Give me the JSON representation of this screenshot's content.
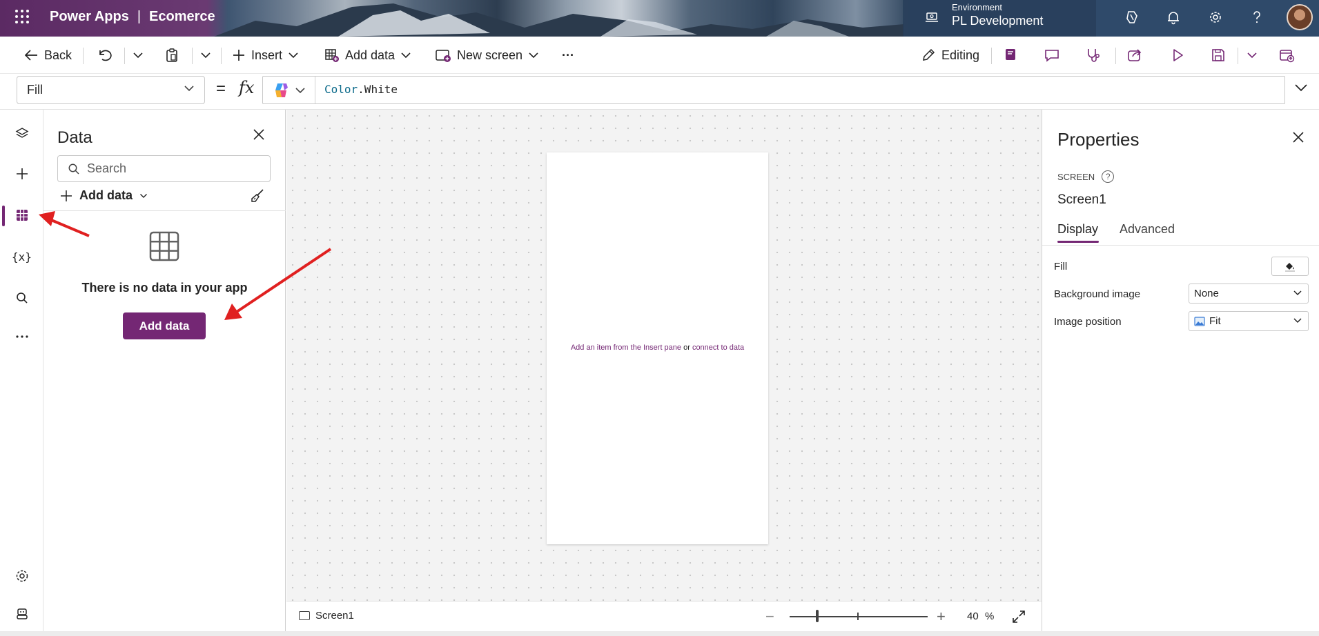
{
  "header": {
    "app_name": "Power Apps",
    "separator": "|",
    "app_title": "Ecomerce",
    "environment_label": "Environment",
    "environment_name": "PL Development"
  },
  "command_bar": {
    "back": "Back",
    "insert": "Insert",
    "add_data": "Add data",
    "new_screen": "New screen",
    "more": "···",
    "editing": "Editing"
  },
  "formula_bar": {
    "property": "Fill",
    "equals": "=",
    "fx": "fx",
    "formula_keyword": "Color",
    "formula_rest": ".White"
  },
  "data_pane": {
    "title": "Data",
    "search_placeholder": "Search",
    "add_data_link": "Add data",
    "empty_message": "There is no data in your app",
    "add_data_button": "Add data"
  },
  "canvas": {
    "hint_part1": "Add an item from the Insert pane",
    "hint_or": "or",
    "hint_part2": "connect to data"
  },
  "status_bar": {
    "screen_name": "Screen1",
    "zoom_minus": "−",
    "zoom_plus": "+",
    "zoom_value": "40",
    "zoom_unit": "%"
  },
  "properties": {
    "title": "Properties",
    "caption": "SCREEN",
    "screen_name": "Screen1",
    "tabs": [
      "Display",
      "Advanced"
    ],
    "fill_label": "Fill",
    "background_image_label": "Background image",
    "background_image_value": "None",
    "image_position_label": "Image position",
    "image_position_value": "Fit"
  },
  "colors": {
    "accent": "#742774",
    "annotation_arrow": "#e02020"
  }
}
